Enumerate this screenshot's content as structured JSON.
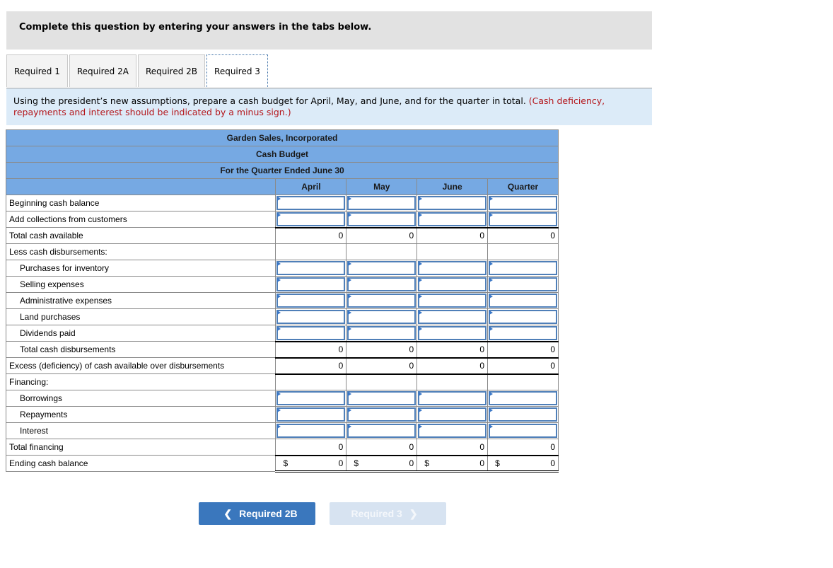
{
  "instructions": "Complete this question by entering your answers in the tabs below.",
  "tabs": [
    {
      "label": "Required 1",
      "active": false
    },
    {
      "label": "Required 2A",
      "active": false
    },
    {
      "label": "Required 2B",
      "active": false
    },
    {
      "label": "Required 3",
      "active": true
    }
  ],
  "prompt": {
    "text": "Using the president’s new assumptions, prepare a cash budget for April, May, and June, and for the quarter in total.",
    "note": "(Cash deficiency, repayments and interest should be indicated by a minus sign.)"
  },
  "budget": {
    "company": "Garden Sales, Incorporated",
    "title": "Cash Budget",
    "period": "For the Quarter Ended June 30",
    "columns": [
      "April",
      "May",
      "June",
      "Quarter"
    ],
    "rows": {
      "beginning_cash": {
        "label": "Beginning cash balance",
        "values": [
          "",
          "",
          "",
          ""
        ]
      },
      "collections": {
        "label": "Add collections from customers",
        "values": [
          "",
          "",
          "",
          ""
        ]
      },
      "total_cash_available": {
        "label": "Total cash available",
        "values": [
          "0",
          "0",
          "0",
          "0"
        ]
      },
      "less_disbursements": {
        "label": "Less cash disbursements:"
      },
      "purchases": {
        "label": "Purchases for inventory",
        "values": [
          "",
          "",
          "",
          ""
        ]
      },
      "selling": {
        "label": "Selling expenses",
        "values": [
          "",
          "",
          "",
          ""
        ]
      },
      "administrative": {
        "label": "Administrative expenses",
        "values": [
          "",
          "",
          "",
          ""
        ]
      },
      "land": {
        "label": "Land purchases",
        "values": [
          "",
          "",
          "",
          ""
        ]
      },
      "dividends": {
        "label": "Dividends paid",
        "values": [
          "",
          "",
          "",
          ""
        ]
      },
      "total_disbursements": {
        "label": "Total cash disbursements",
        "values": [
          "0",
          "0",
          "0",
          "0"
        ]
      },
      "excess": {
        "label": "Excess (deficiency) of cash available over disbursements",
        "values": [
          "0",
          "0",
          "0",
          "0"
        ]
      },
      "financing": {
        "label": "Financing:"
      },
      "borrowings": {
        "label": "Borrowings",
        "values": [
          "",
          "",
          "",
          ""
        ]
      },
      "repayments": {
        "label": "Repayments",
        "values": [
          "",
          "",
          "",
          ""
        ]
      },
      "interest": {
        "label": "Interest",
        "values": [
          "",
          "",
          "",
          ""
        ]
      },
      "total_financing": {
        "label": "Total financing",
        "values": [
          "0",
          "0",
          "0",
          "0"
        ]
      },
      "ending_cash": {
        "label": "Ending cash balance",
        "currency": "$",
        "values": [
          "0",
          "0",
          "0",
          "0"
        ]
      }
    }
  },
  "nav": {
    "prev_label": "Required 2B",
    "next_label": "Required 3",
    "prev_icon": "chevron-left-icon",
    "next_icon": "chevron-right-icon"
  },
  "colors": {
    "header_blue": "#76a9e3",
    "prompt_bg": "#dcebf8",
    "note_red": "#b4161b",
    "button_blue": "#3a77bd",
    "button_disabled": "#d7e3f1"
  }
}
